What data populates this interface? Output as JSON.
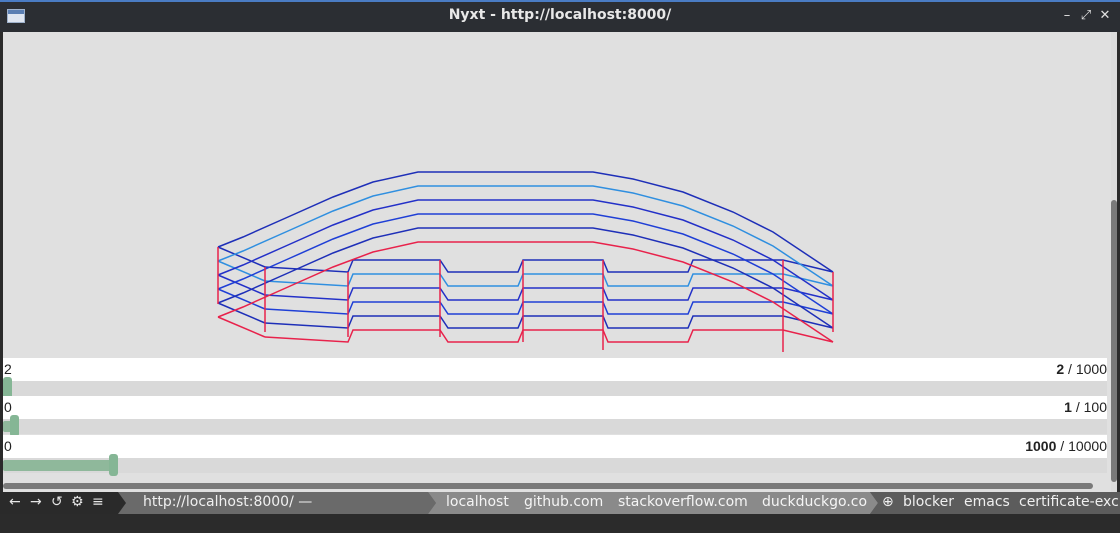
{
  "window": {
    "title": "Nyxt - http://localhost:8000/"
  },
  "sliders": [
    {
      "min": "0",
      "value": "2",
      "max": "1000",
      "fraction": 0.002
    },
    {
      "min": "0",
      "value": "1",
      "max": "100",
      "fraction": 0.01
    },
    {
      "min": "0",
      "value": "1000",
      "max": "10000",
      "fraction": 0.1
    }
  ],
  "slider_top_label": "2",
  "statusbar": {
    "controls": {
      "back": "←",
      "forward": "→",
      "reload": "↺",
      "settings": "⚙",
      "menu": "≡"
    },
    "url": "http://localhost:8000/ —",
    "tabs": [
      "localhost",
      "github.com",
      "stackoverflow.com",
      "duckduckgo.co"
    ],
    "modes_icon": "⊕",
    "modes": [
      "blocker",
      "emacs",
      "certificate-exc"
    ]
  },
  "colors": {
    "background": "#e0e0e0",
    "lines": [
      "#e8224b",
      "#1e2fb8",
      "#2f8fe0",
      "#2330c8",
      "#1f3fd6"
    ],
    "slider": "#8fb89b"
  }
}
